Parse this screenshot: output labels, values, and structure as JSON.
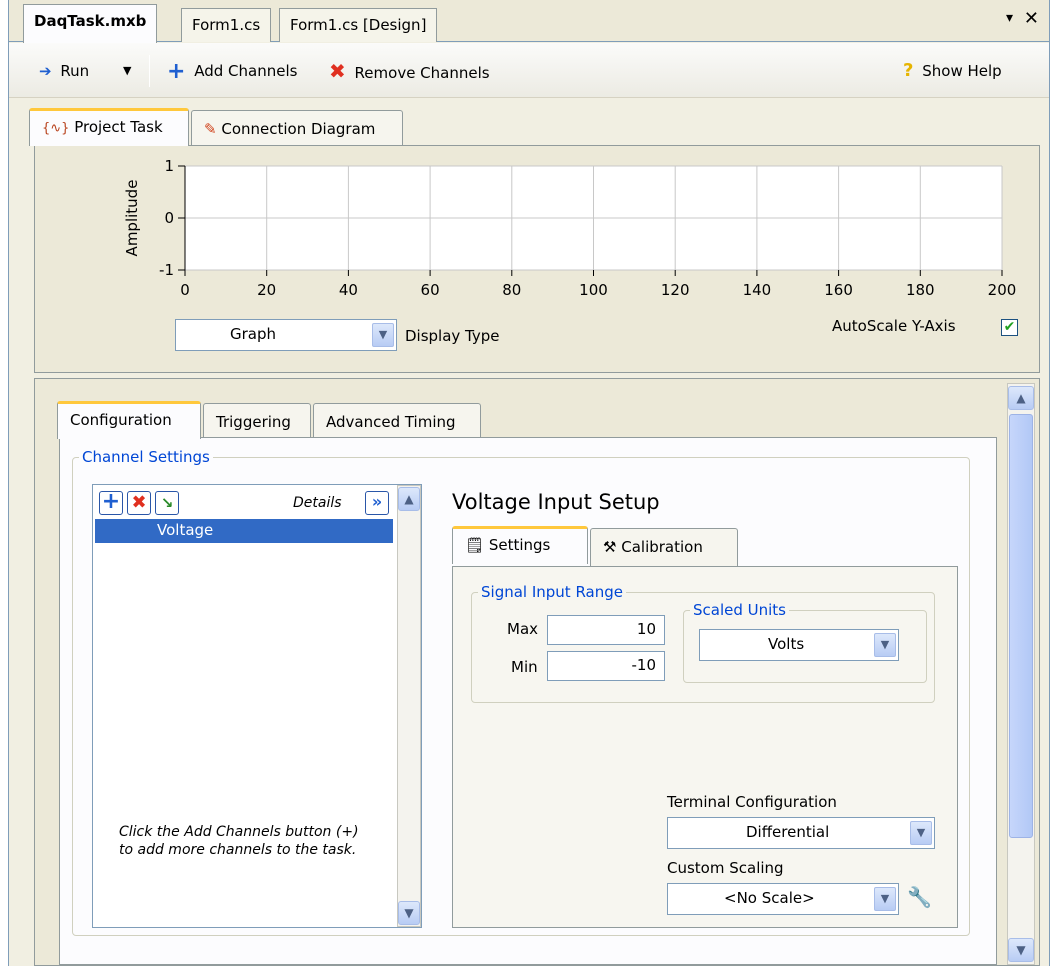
{
  "doc_tabs": [
    {
      "label": "DaqTask.mxb",
      "active": true
    },
    {
      "label": "Form1.cs",
      "active": false
    },
    {
      "label": "Form1.cs [Design]",
      "active": false
    }
  ],
  "window_controls": {
    "menu": "▾",
    "close": "✕"
  },
  "toolbar": {
    "run_label": "Run",
    "add_channels_label": "Add Channels",
    "remove_channels_label": "Remove Channels",
    "show_help_label": "Show Help"
  },
  "view_tabs": [
    {
      "label": "Project Task",
      "active": true
    },
    {
      "label": "Connection Diagram",
      "active": false
    }
  ],
  "graph": {
    "ylabel": "Amplitude",
    "display_type_value": "Graph",
    "display_type_label": "Display Type",
    "autoscale_label": "AutoScale Y-Axis",
    "autoscale_checked": true
  },
  "chart_data": {
    "type": "line",
    "title": "",
    "xlabel": "",
    "ylabel": "Amplitude",
    "xlim": [
      0,
      200
    ],
    "ylim": [
      -1,
      1
    ],
    "x_ticks": [
      "0",
      "20",
      "40",
      "60",
      "80",
      "100",
      "120",
      "140",
      "160",
      "180",
      "200"
    ],
    "y_ticks": [
      "1",
      "0",
      "-1"
    ],
    "grid": true,
    "series": []
  },
  "config_tabs": [
    {
      "label": "Configuration",
      "active": true
    },
    {
      "label": "Triggering",
      "active": false
    },
    {
      "label": "Advanced Timing",
      "active": false
    }
  ],
  "channel_settings": {
    "legend": "Channel Settings",
    "details_label": "Details",
    "channels": [
      "Voltage"
    ],
    "hint": "Click the Add Channels button (+) to add more channels to the task."
  },
  "voltage_setup": {
    "title": "Voltage Input Setup",
    "tabs": [
      {
        "label": "Settings",
        "active": true
      },
      {
        "label": "Calibration",
        "active": false
      }
    ],
    "signal_range_legend": "Signal Input Range",
    "max_label": "Max",
    "max_value": "10",
    "min_label": "Min",
    "min_value": "-10",
    "scaled_units_legend": "Scaled Units",
    "scaled_units_value": "Volts",
    "terminal_config_label": "Terminal Configuration",
    "terminal_config_value": "Differential",
    "custom_scaling_label": "Custom Scaling",
    "custom_scaling_value": "<No Scale>"
  },
  "colors": {
    "selection": "#316ac5",
    "group_legend": "#0046d5",
    "active_tab_accent": "#ffc83c",
    "remove_red": "#e03020",
    "add_blue": "#1f5fd0"
  }
}
